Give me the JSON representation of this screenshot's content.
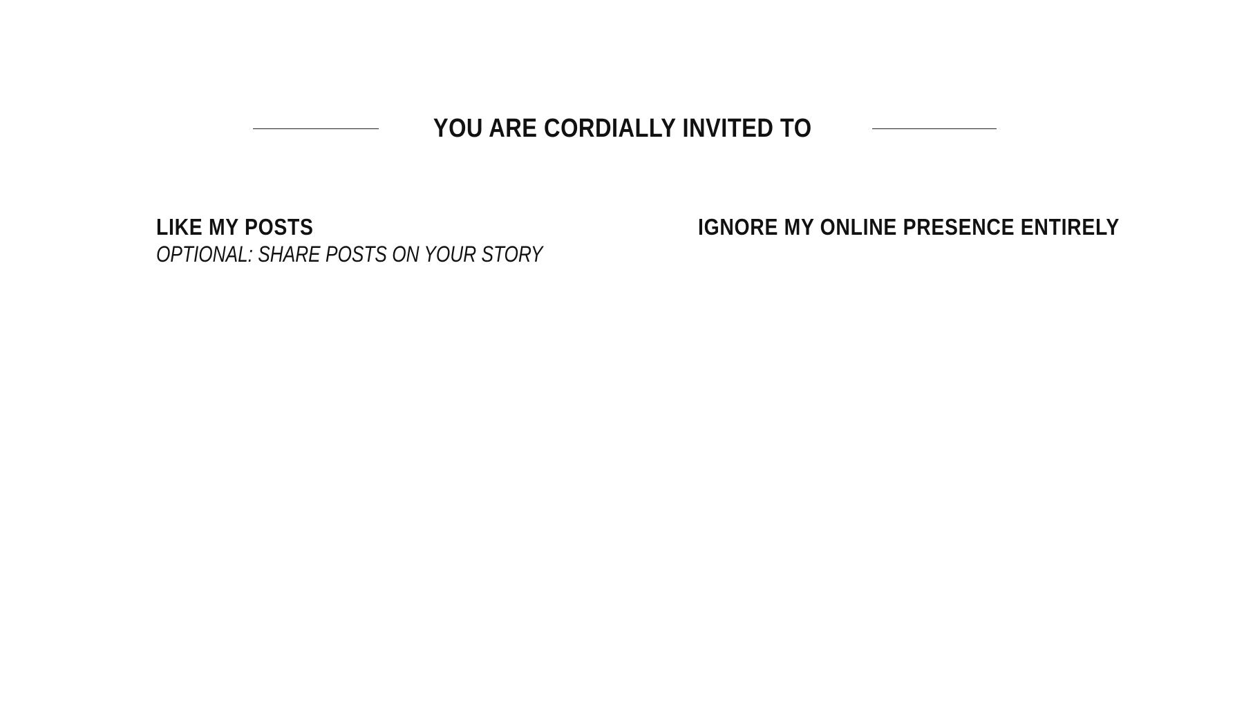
{
  "invitation": {
    "headline": "YOU ARE CORDIALLY INVITED TO",
    "options": [
      {
        "title": "LIKE MY POSTS",
        "note": "OPTIONAL: SHARE POSTS ON YOUR STORY"
      },
      {
        "title": "IGNORE MY ONLINE PRESENCE ENTIRELY"
      }
    ]
  }
}
